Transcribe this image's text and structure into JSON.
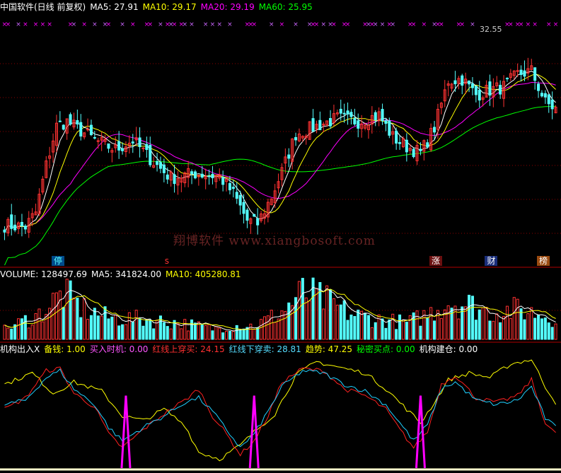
{
  "header": {
    "title": "中国软件(日线 前复权)",
    "ma5": "MA5: 27.91",
    "ma10": "MA10: 29.17",
    "ma20": "MA20: 29.19",
    "ma60": "MA60: 25.95"
  },
  "volume_header": {
    "volume": "VOLUME: 128497.69",
    "ma5": "MA5: 341824.00",
    "ma10": "MA10: 405280.81"
  },
  "indicator_header": {
    "name": "机构出入X",
    "beiqian": "备钱: 1.00",
    "mairu": "买入时机: 0.00",
    "hongshang": "红线上穿买: 24.15",
    "hongxia": "红线下穿卖: 28.81",
    "qushi": "趋势: 47.25",
    "mimi": "秘密买点: 0.00",
    "jigou": "机构建仓: 0.00"
  },
  "price_peak_label": "32.55",
  "watermark": "翔博软件 www.xiangbosoft.com",
  "event_badges": [
    {
      "label": "停",
      "color": "#55ffff",
      "bg": "#004a8a",
      "x_index": 15
    },
    {
      "label": "s",
      "color": "#ff3333",
      "bg": "#000000",
      "x_index": 47
    },
    {
      "label": "涨",
      "color": "#ffffff",
      "bg": "#6b1010",
      "x_index": 124
    },
    {
      "label": "财",
      "color": "#ffffff",
      "bg": "#1a2e7a",
      "x_index": 140
    },
    {
      "label": "榜",
      "color": "#ffffff",
      "bg": "#9a4a10",
      "x_index": 155
    }
  ],
  "colors": {
    "up": "#ff3232",
    "down": "#54ffff",
    "ma5": "#ffffff",
    "ma10": "#ffff00",
    "ma20": "#ff00ff",
    "ma60": "#00ff00",
    "grid": "#8b0000",
    "axis": "#b00000",
    "ind_yellow": "#ffff00",
    "ind_red": "#ff2020",
    "ind_cyan": "#20d0ff",
    "ind_magenta": "#ff00ff"
  },
  "chart_data": {
    "type": "candlestick",
    "title": "中国软件(日线 前复权)",
    "bars": 160,
    "price_range": [
      20.0,
      33.5
    ],
    "price_anchor_points": [
      [
        0,
        21.2
      ],
      [
        6,
        21.1
      ],
      [
        9,
        22.0
      ],
      [
        12,
        25.0
      ],
      [
        15,
        27.5
      ],
      [
        18,
        27.8
      ],
      [
        22,
        27.2
      ],
      [
        27,
        26.5
      ],
      [
        32,
        26.0
      ],
      [
        37,
        26.6
      ],
      [
        43,
        25.2
      ],
      [
        48,
        24.2
      ],
      [
        55,
        24.5
      ],
      [
        62,
        24.3
      ],
      [
        66,
        23.2
      ],
      [
        70,
        21.5
      ],
      [
        73,
        21.3
      ],
      [
        77,
        23.0
      ],
      [
        80,
        24.6
      ],
      [
        84,
        27.0
      ],
      [
        90,
        27.5
      ],
      [
        96,
        28.0
      ],
      [
        102,
        27.8
      ],
      [
        108,
        28.2
      ],
      [
        112,
        26.8
      ],
      [
        116,
        26.2
      ],
      [
        120,
        25.8
      ],
      [
        124,
        27.4
      ],
      [
        128,
        30.4
      ],
      [
        132,
        30.5
      ],
      [
        136,
        29.5
      ],
      [
        140,
        29.8
      ],
      [
        144,
        30.0
      ],
      [
        148,
        30.8
      ],
      [
        152,
        31.0
      ],
      [
        156,
        29.0
      ],
      [
        159,
        28.6
      ]
    ],
    "volume_anchor_points": [
      [
        0,
        120000
      ],
      [
        10,
        300000
      ],
      [
        17,
        560000
      ],
      [
        22,
        380000
      ],
      [
        30,
        260000
      ],
      [
        40,
        240000
      ],
      [
        50,
        200000
      ],
      [
        60,
        130000
      ],
      [
        68,
        170000
      ],
      [
        72,
        160000
      ],
      [
        80,
        330000
      ],
      [
        86,
        560000
      ],
      [
        92,
        480000
      ],
      [
        100,
        300000
      ],
      [
        108,
        240000
      ],
      [
        116,
        200000
      ],
      [
        122,
        300000
      ],
      [
        128,
        460000
      ],
      [
        134,
        420000
      ],
      [
        140,
        330000
      ],
      [
        148,
        360000
      ],
      [
        155,
        300000
      ],
      [
        159,
        250000
      ]
    ],
    "volume_range": [
      0,
      700000
    ],
    "indicator_range": [
      0,
      100
    ],
    "indicator_series": [
      {
        "name": "趋势",
        "color": "#ffff00",
        "anchors": [
          [
            0,
            74
          ],
          [
            8,
            84
          ],
          [
            14,
            66
          ],
          [
            20,
            76
          ],
          [
            28,
            68
          ],
          [
            34,
            46
          ],
          [
            40,
            42
          ],
          [
            46,
            52
          ],
          [
            52,
            38
          ],
          [
            56,
            14
          ],
          [
            62,
            8
          ],
          [
            68,
            20
          ],
          [
            72,
            32
          ],
          [
            78,
            48
          ],
          [
            84,
            82
          ],
          [
            90,
            94
          ],
          [
            98,
            88
          ],
          [
            104,
            84
          ],
          [
            110,
            70
          ],
          [
            116,
            52
          ],
          [
            120,
            40
          ],
          [
            124,
            58
          ],
          [
            128,
            78
          ],
          [
            134,
            84
          ],
          [
            140,
            80
          ],
          [
            146,
            92
          ],
          [
            152,
            96
          ],
          [
            156,
            72
          ],
          [
            159,
            58
          ]
        ]
      },
      {
        "name": "红线",
        "color": "#ff2020",
        "anchors": [
          [
            0,
            52
          ],
          [
            6,
            62
          ],
          [
            12,
            86
          ],
          [
            16,
            88
          ],
          [
            20,
            66
          ],
          [
            26,
            54
          ],
          [
            30,
            30
          ],
          [
            34,
            18
          ],
          [
            40,
            34
          ],
          [
            46,
            48
          ],
          [
            52,
            60
          ],
          [
            56,
            70
          ],
          [
            60,
            46
          ],
          [
            64,
            30
          ],
          [
            68,
            12
          ],
          [
            72,
            24
          ],
          [
            76,
            46
          ],
          [
            80,
            76
          ],
          [
            86,
            88
          ],
          [
            92,
            86
          ],
          [
            98,
            70
          ],
          [
            104,
            64
          ],
          [
            110,
            52
          ],
          [
            114,
            34
          ],
          [
            118,
            18
          ],
          [
            122,
            32
          ],
          [
            126,
            74
          ],
          [
            130,
            82
          ],
          [
            136,
            62
          ],
          [
            142,
            58
          ],
          [
            148,
            64
          ],
          [
            152,
            78
          ],
          [
            156,
            40
          ],
          [
            159,
            30
          ]
        ]
      },
      {
        "name": "蓝线",
        "color": "#20d0ff",
        "anchors": [
          [
            0,
            56
          ],
          [
            6,
            60
          ],
          [
            12,
            80
          ],
          [
            16,
            86
          ],
          [
            20,
            70
          ],
          [
            26,
            56
          ],
          [
            30,
            36
          ],
          [
            34,
            24
          ],
          [
            40,
            36
          ],
          [
            46,
            46
          ],
          [
            52,
            58
          ],
          [
            56,
            62
          ],
          [
            60,
            50
          ],
          [
            64,
            34
          ],
          [
            68,
            18
          ],
          [
            72,
            30
          ],
          [
            76,
            50
          ],
          [
            80,
            72
          ],
          [
            86,
            86
          ],
          [
            92,
            84
          ],
          [
            98,
            74
          ],
          [
            104,
            68
          ],
          [
            110,
            56
          ],
          [
            114,
            40
          ],
          [
            118,
            24
          ],
          [
            122,
            38
          ],
          [
            126,
            70
          ],
          [
            130,
            76
          ],
          [
            136,
            60
          ],
          [
            142,
            56
          ],
          [
            148,
            60
          ],
          [
            152,
            72
          ],
          [
            156,
            44
          ],
          [
            159,
            36
          ]
        ]
      }
    ],
    "buy_signal_indices": [
      35,
      72,
      120
    ]
  }
}
